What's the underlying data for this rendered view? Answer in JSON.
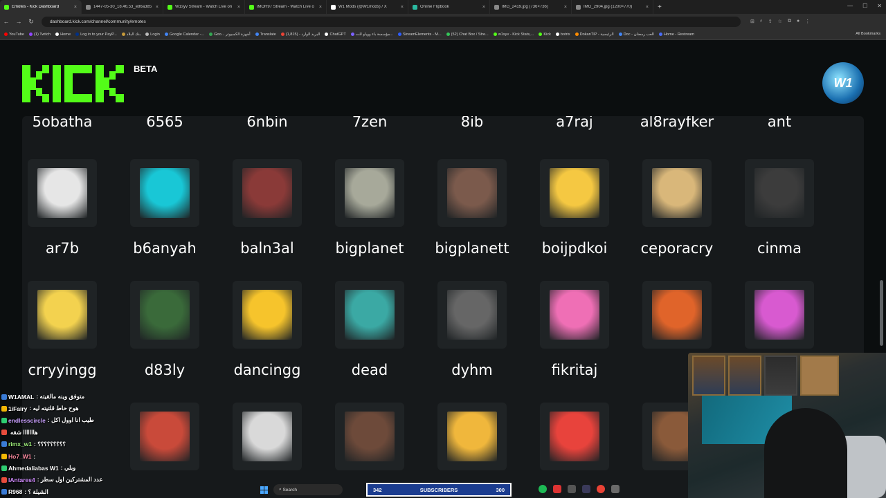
{
  "browser": {
    "tabs": [
      {
        "label": "Emotes - Kick Dashboard",
        "color": "#53fc18",
        "active": true
      },
      {
        "label": "1447-05-30_18.46.53_e86a385",
        "color": "#888888"
      },
      {
        "label": "W1syv Stream - Watch Live on",
        "color": "#53fc18"
      },
      {
        "label": "iMOH97 Stream - Watch Live o",
        "color": "#53fc18"
      },
      {
        "label": "W1 Mods (@W1mods) / X",
        "color": "#ffffff"
      },
      {
        "label": "Online Flipbook",
        "color": "#2ab9a0"
      },
      {
        "label": "IMG_2419.jpg (736×736)",
        "color": "#888888"
      },
      {
        "label": "IMG_2904.jpg (1200×770)",
        "color": "#888888"
      }
    ],
    "url": "dashboard.kick.com/channel/community/emotes",
    "bookmarks": [
      {
        "label": "YouTube",
        "color": "#ff0000"
      },
      {
        "label": "(1) Twitch",
        "color": "#9146ff"
      },
      {
        "label": "Home",
        "color": "#ffffff"
      },
      {
        "label": "Log in to your PayP...",
        "color": "#003087"
      },
      {
        "label": "بنك البلاد",
        "color": "#c79a3a"
      },
      {
        "label": "Login",
        "color": "#bbbbbb"
      },
      {
        "label": "Google Calendar -...",
        "color": "#4285f4"
      },
      {
        "label": "Goo... أجهزة الكمبيوتر",
        "color": "#34a853"
      },
      {
        "label": "Translate",
        "color": "#4285f4"
      },
      {
        "label": "البريد الوارد - (1,815)",
        "color": "#ea4335"
      },
      {
        "label": "ChatGPT",
        "color": "#ffffff"
      },
      {
        "label": "مؤسسة باء ووياو للت...",
        "color": "#7b61ff"
      },
      {
        "label": "StreamElements - M...",
        "color": "#2c5cff"
      },
      {
        "label": "(52) Chat Box / Stre...",
        "color": "#34c759"
      },
      {
        "label": "w1syv - Kick Stats,...",
        "color": "#53fc18"
      },
      {
        "label": "Kick",
        "color": "#53fc18"
      },
      {
        "label": "botrix",
        "color": "#ffffff"
      },
      {
        "label": "DokanTIP - الرئيسية",
        "color": "#ff8c00"
      },
      {
        "label": "Doc - العب رمضان",
        "color": "#4285f4"
      },
      {
        "label": "Home - Restream",
        "color": "#4a6cf7"
      }
    ],
    "all_bookmarks": "All Bookmarks"
  },
  "header": {
    "logo_text": "KICK",
    "beta": "BETA",
    "avatar_text": "W1",
    "brand_color": "#53fc18"
  },
  "emotes": {
    "partial_row": [
      "5obatha",
      "6565",
      "6nbin",
      "7zen",
      "8ib",
      "a7raj",
      "al8rayfker",
      "ant"
    ],
    "rows": [
      [
        {
          "name": "ar7b",
          "color": "#e6e6e6"
        },
        {
          "name": "b6anyah",
          "color": "#19c7d6"
        },
        {
          "name": "baln3al",
          "color": "#8a3a38"
        },
        {
          "name": "bigplanet",
          "color": "#a7a99a"
        },
        {
          "name": "bigplanett",
          "color": "#7b5a4c"
        },
        {
          "name": "boijpdkoi",
          "color": "#f5c842"
        },
        {
          "name": "ceporacry",
          "color": "#d9b77a"
        },
        {
          "name": "cinma",
          "color": "#3c3c3c"
        }
      ],
      [
        {
          "name": "crryyingg",
          "color": "#f3d24f"
        },
        {
          "name": "d83ly",
          "color": "#3a6a3a"
        },
        {
          "name": "dancingg",
          "color": "#f6c42c"
        },
        {
          "name": "dead",
          "color": "#3ba9a4"
        },
        {
          "name": "dyhm",
          "color": "#666666"
        },
        {
          "name": "fikritaj",
          "color": "#ef6fb5"
        },
        {
          "name": "",
          "color": "#e0642a"
        },
        {
          "name": "",
          "color": "#d85ad0"
        }
      ],
      [
        {
          "name": "",
          "color": "#2a2a2a",
          "hidden": true
        },
        {
          "name": "",
          "color": "#c94a3a"
        },
        {
          "name": "",
          "color": "#d9d9d9"
        },
        {
          "name": "",
          "color": "#6d4a3a"
        },
        {
          "name": "",
          "color": "#f0b73c"
        },
        {
          "name": "",
          "color": "#e8433c"
        },
        {
          "name": "",
          "color": "#8a5a3a"
        },
        {
          "name": "",
          "color": "#2a2a2a",
          "hidden": true
        }
      ]
    ]
  },
  "chat": [
    {
      "user": "W1AMAL",
      "msg": ": متوفق وينه مالقيته",
      "color": "#ffffff"
    },
    {
      "user": "1iFairy",
      "msg": ": هوح حاط قلتيته ليه",
      "color": "#ffffff"
    },
    {
      "user": "endlesscircle",
      "msg": ": طيب انا اوول اكل",
      "color": "#c9a0ff"
    },
    {
      "user": "",
      "msg": "هااااااا شقه",
      "color": "#ffffff"
    },
    {
      "user": "rimx_w1",
      "msg": ": ؟؟؟؟؟؟؟؟؟",
      "color": "#9ff07a"
    },
    {
      "user": "Ho7_W1",
      "msg": ":",
      "color": "#ff8aa0"
    },
    {
      "user": "Ahmedaliabas W1",
      "msg": ": وبلي",
      "color": "#ffffff"
    },
    {
      "user": "lAntares4",
      "msg": ": عدد المشتركين اول سطر",
      "color": "#d08bff"
    },
    {
      "user": "R968",
      "msg": ": الشيلة ؟",
      "color": "#ffffff"
    }
  ],
  "subscribers": {
    "left": "342",
    "label": "SUBSCRIBERS",
    "right": "300"
  },
  "taskbar": {
    "search": "Search"
  }
}
